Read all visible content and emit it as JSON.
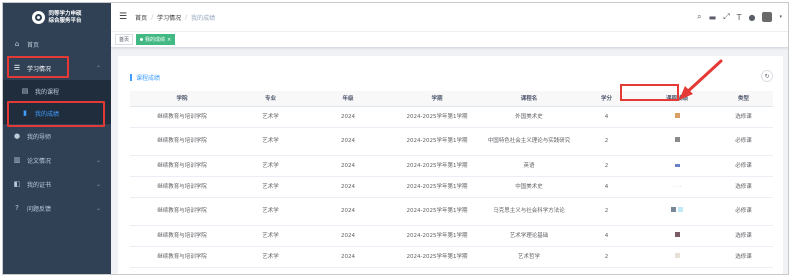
{
  "sidebar": {
    "logo_line1": "同等学力申硕",
    "logo_line2": "综合服务平台",
    "items": [
      {
        "label": "首页",
        "icon": "home-icon"
      },
      {
        "label": "学习情况",
        "icon": "list-icon"
      },
      {
        "label": "我的课程",
        "icon": "book-icon"
      },
      {
        "label": "我的成绩",
        "icon": "chart-icon"
      },
      {
        "label": "我的导师",
        "icon": "user-icon"
      },
      {
        "label": "论文情况",
        "icon": "document-icon"
      },
      {
        "label": "我的证书",
        "icon": "certificate-icon"
      },
      {
        "label": "问题反馈",
        "icon": "help-icon"
      }
    ]
  },
  "navbar": {
    "breadcrumb": [
      "首页",
      "学习情况",
      "我的成绩"
    ]
  },
  "tags": {
    "home": "首页",
    "active": "我的成绩"
  },
  "card": {
    "title": "课程成绩"
  },
  "table": {
    "headers": [
      "学院",
      "专业",
      "年级",
      "学期",
      "课程名",
      "学分",
      "课程成绩",
      "类型"
    ],
    "rows": [
      {
        "college": "继续教育与培训学院",
        "major": "艺术学",
        "grade": "2024",
        "term": "2024-2025学年第1学期",
        "course": "外国美术史",
        "credit": "4",
        "type": "选修课"
      },
      {
        "college": "继续教育与培训学院",
        "major": "艺术学",
        "grade": "2024",
        "term": "2024-2025学年第1学期",
        "course": "中国特色社会主义理论与实践研究",
        "credit": "2",
        "type": "必修课"
      },
      {
        "college": "继续教育与培训学院",
        "major": "艺术学",
        "grade": "2024",
        "term": "2024-2025学年第1学期",
        "course": "英语",
        "credit": "2",
        "type": "必修课"
      },
      {
        "college": "继续教育与培训学院",
        "major": "艺术学",
        "grade": "2024",
        "term": "2024-2025学年第1学期",
        "course": "中国美术史",
        "credit": "4",
        "type": "选修课"
      },
      {
        "college": "继续教育与培训学院",
        "major": "艺术学",
        "grade": "2024",
        "term": "2024-2025学年第1学期",
        "course": "马克思主义与社会科学方法论",
        "credit": "2",
        "type": "必修课"
      },
      {
        "college": "继续教育与培训学院",
        "major": "艺术学",
        "grade": "2024",
        "term": "2024-2025学年第1学期",
        "course": "艺术学理论基础",
        "credit": "4",
        "type": "选修课"
      },
      {
        "college": "继续教育与培训学院",
        "major": "艺术学",
        "grade": "2024",
        "term": "2024-2025学年第1学期",
        "course": "艺术哲学",
        "credit": "2",
        "type": "选修课"
      }
    ]
  },
  "colors": {
    "sidebar_bg": "#304156",
    "accent": "#409eff",
    "tag_active": "#42b983",
    "annotation_red": "#e53935"
  }
}
